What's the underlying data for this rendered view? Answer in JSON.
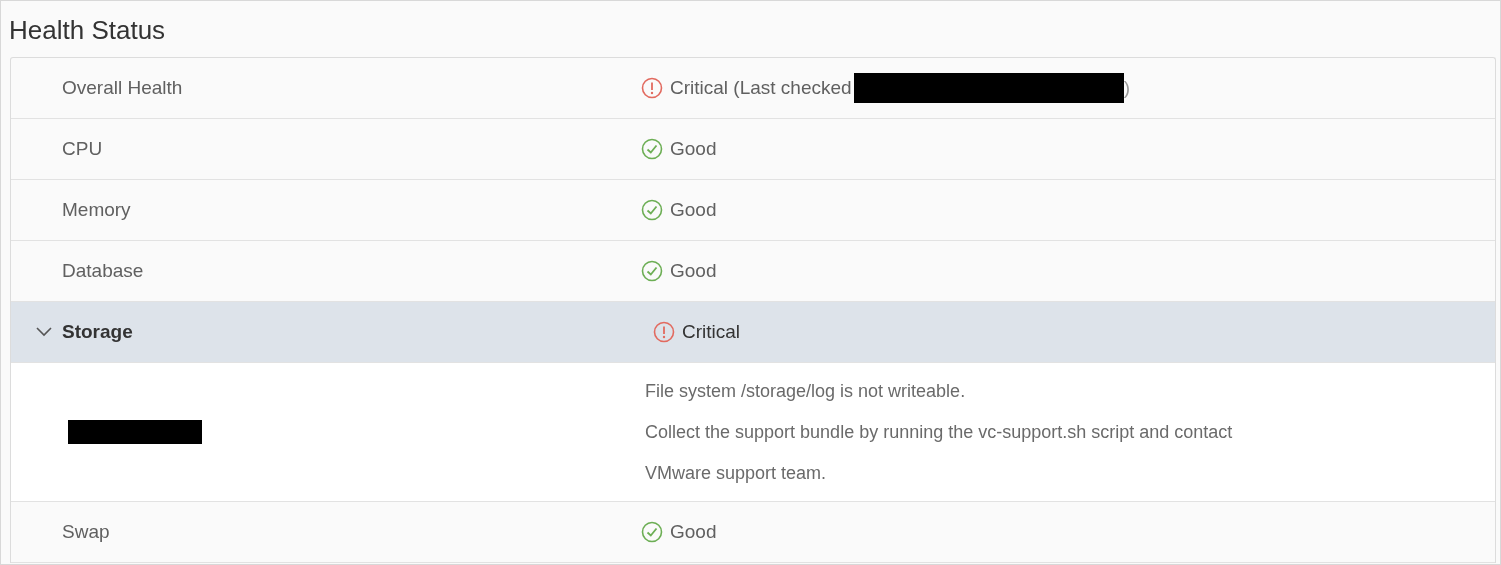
{
  "title": "Health Status",
  "rows": [
    {
      "name": "Overall Health",
      "selected": false,
      "status": {
        "kind": "critical",
        "text": "Critical (Last checked",
        "redacted": true,
        "suffix": ")"
      }
    },
    {
      "name": "CPU",
      "selected": false,
      "status": {
        "kind": "good",
        "text": "Good"
      }
    },
    {
      "name": "Memory",
      "selected": false,
      "status": {
        "kind": "good",
        "text": "Good"
      }
    },
    {
      "name": "Database",
      "selected": false,
      "status": {
        "kind": "good",
        "text": "Good"
      }
    },
    {
      "name": "Storage",
      "selected": true,
      "expanded": true,
      "status": {
        "kind": "critical",
        "text": "Critical"
      },
      "detail": {
        "label_redacted": true,
        "lines": [
          "File system /storage/log is not writeable.",
          "Collect the support bundle by running the vc-support.sh script and contact",
          "VMware support team."
        ]
      }
    },
    {
      "name": "Swap",
      "selected": false,
      "status": {
        "kind": "good",
        "text": "Good"
      }
    }
  ]
}
